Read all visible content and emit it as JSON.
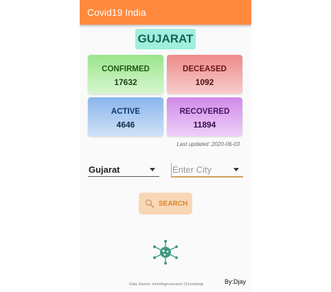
{
  "app": {
    "title": "Covid19 India"
  },
  "state_title": "GUJARAT",
  "cards": {
    "confirmed": {
      "label": "CONFIRMED",
      "value": "17632"
    },
    "deceased": {
      "label": "DECEASED",
      "value": "1092"
    },
    "active": {
      "label": "ACTIVE",
      "value": "4646"
    },
    "recovered": {
      "label": "RECOVERED",
      "value": "11894"
    }
  },
  "last_updated": "Last updated :2020-06-03",
  "state_select": {
    "selected": "Gujarat"
  },
  "city_select": {
    "placeholder": "Enter City"
  },
  "search_button": {
    "label": "SEARCH"
  },
  "footer": {
    "data_source": "Data Source: incmilngeroussenl 111nowlvag",
    "credit": "By:Djay"
  },
  "colors": {
    "appbar": "#ff8a3d",
    "state_title_bg": "#9ef0dc",
    "confirmed": "#9be58b",
    "deceased": "#ee8a8a",
    "active": "#8ab6ec",
    "recovered": "#d08ae9",
    "search_bg": "#f8d7b7"
  },
  "icons": [
    "dropdown-caret-icon",
    "search-icon",
    "virus-icon"
  ]
}
